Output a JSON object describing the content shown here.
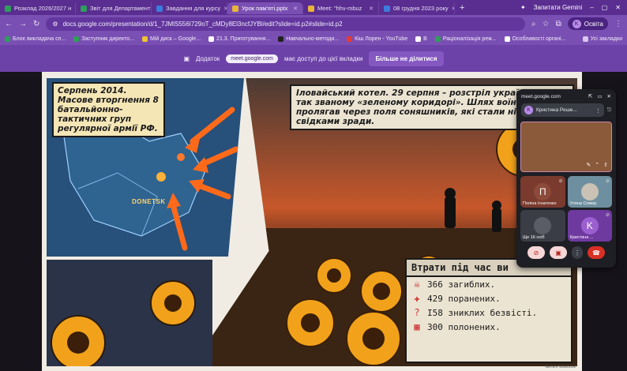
{
  "browser": {
    "tabs": [
      {
        "label": "Розклад 2026/2027 н",
        "color": "#2e9e5b"
      },
      {
        "label": "Звіт для Департамент",
        "color": "#2e9e5b"
      },
      {
        "label": "Завдання для курсу",
        "color": "#3b7ddd"
      },
      {
        "label": "Урок пам'яті.pptx",
        "color": "#e8b53a"
      },
      {
        "label": "Meet: \"hhv-mbuz",
        "color": "#e8b53a"
      },
      {
        "label": "08 грудня 2023 року",
        "color": "#3b7ddd"
      }
    ],
    "gemini_label": "Запитати Gemini",
    "url": "docs.google.com/presentation/d/1_7JMlS556I729oT_cMDy8El3ncfJYBl/edit?slide=id.p2#slide=id.p2",
    "profile_initial": "K",
    "profile_label": "Освіта",
    "bookmarks": [
      "Блоє викладача сп...",
      "Заступник директо...",
      "Мій диск – Google...",
      "21.3. Приготування...",
      "Навчально-методи...",
      "Кіш Лорен - YouTube",
      "B",
      "Раціоналізація реж...",
      "Особливості органі..."
    ],
    "all_bookmarks": "Усі закладки"
  },
  "share_bar": {
    "prefix": "Додаток",
    "app": "meet.google.com",
    "suffix": "має доступ до цієї вкладки",
    "stop_button": "Більше не ділитися"
  },
  "slide": {
    "caption1": "Серпень 2014. Масове вторгнення 8 батальйонно-тактичних груп регулярної армії РФ.",
    "map_label": "DONETSK",
    "caption2": "Іловайський котел. 29 серпня – розстріл україн колон у так званому «зеленому коридорі». Шлях воїнів пролягав через поля соняшників, які стали німими свідками зради.",
    "stats_title": "Втрати під час ви",
    "stats": [
      {
        "icon": "☠",
        "text": "366 загиблих."
      },
      {
        "icon": "✚",
        "text": "429 поранених."
      },
      {
        "icon": "?",
        "text": "I58 зниклих безвісті."
      },
      {
        "icon": "▦",
        "text": "300 полонених."
      }
    ],
    "watermark": "Gemini Notebook"
  },
  "meet": {
    "domain": "meet.google.com",
    "user_initial": "K",
    "user_label": "Кристина Реше...",
    "participants": [
      {
        "initial": "П",
        "name": "Поліна Ігнатенко",
        "bg": "#7a3b2e",
        "circle": "#8c4a3a"
      },
      {
        "initial": "",
        "name": "Уляна Сомер",
        "bg": "#6e8fa0",
        "circle": "#c9c2b5"
      },
      {
        "initial": "",
        "name": "Ще 16 осіб",
        "bg": "#3a3d46",
        "circle": "#5a5d66"
      },
      {
        "initial": "K",
        "name": "Кристина ...",
        "bg": "#6f3aa0",
        "circle": "#9b5fd0"
      }
    ]
  }
}
